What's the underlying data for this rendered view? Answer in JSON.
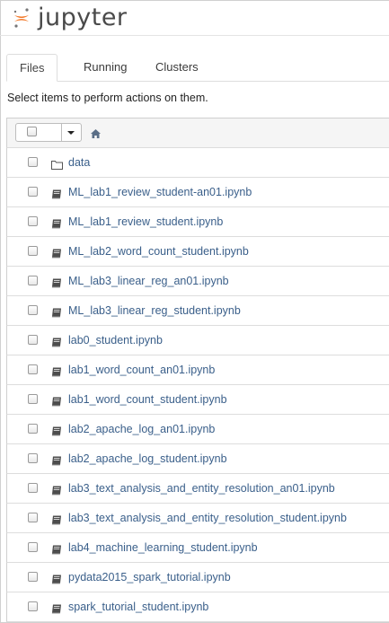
{
  "app": {
    "logo_text": "jupyter"
  },
  "tabs": [
    {
      "label": "Files",
      "active": true
    },
    {
      "label": "Running",
      "active": false
    },
    {
      "label": "Clusters",
      "active": false
    }
  ],
  "notice": "Select items to perform actions on them.",
  "toolbar": {
    "home_icon": "home-icon",
    "dropdown_icon": "caret-down-icon"
  },
  "files": [
    {
      "name": "data",
      "icon": "folder-icon"
    },
    {
      "name": "ML_lab1_review_student-an01.ipynb",
      "icon": "notebook-icon"
    },
    {
      "name": "ML_lab1_review_student.ipynb",
      "icon": "notebook-icon"
    },
    {
      "name": "ML_lab2_word_count_student.ipynb",
      "icon": "notebook-icon"
    },
    {
      "name": "ML_lab3_linear_reg_an01.ipynb",
      "icon": "notebook-icon"
    },
    {
      "name": "ML_lab3_linear_reg_student.ipynb",
      "icon": "notebook-icon"
    },
    {
      "name": "lab0_student.ipynb",
      "icon": "notebook-icon"
    },
    {
      "name": "lab1_word_count_an01.ipynb",
      "icon": "notebook-icon"
    },
    {
      "name": "lab1_word_count_student.ipynb",
      "icon": "notebook-icon"
    },
    {
      "name": "lab2_apache_log_an01.ipynb",
      "icon": "notebook-icon"
    },
    {
      "name": "lab2_apache_log_student.ipynb",
      "icon": "notebook-icon"
    },
    {
      "name": "lab3_text_analysis_and_entity_resolution_an01.ipynb",
      "icon": "notebook-icon"
    },
    {
      "name": "lab3_text_analysis_and_entity_resolution_student.ipynb",
      "icon": "notebook-icon"
    },
    {
      "name": "lab4_machine_learning_student.ipynb",
      "icon": "notebook-icon"
    },
    {
      "name": "pydata2015_spark_tutorial.ipynb",
      "icon": "notebook-icon"
    },
    {
      "name": "spark_tutorial_student.ipynb",
      "icon": "notebook-icon"
    }
  ],
  "colors": {
    "link": "#3a5f8a",
    "logo_orange": "#f37726",
    "header_bg": "#f5f5f5"
  }
}
